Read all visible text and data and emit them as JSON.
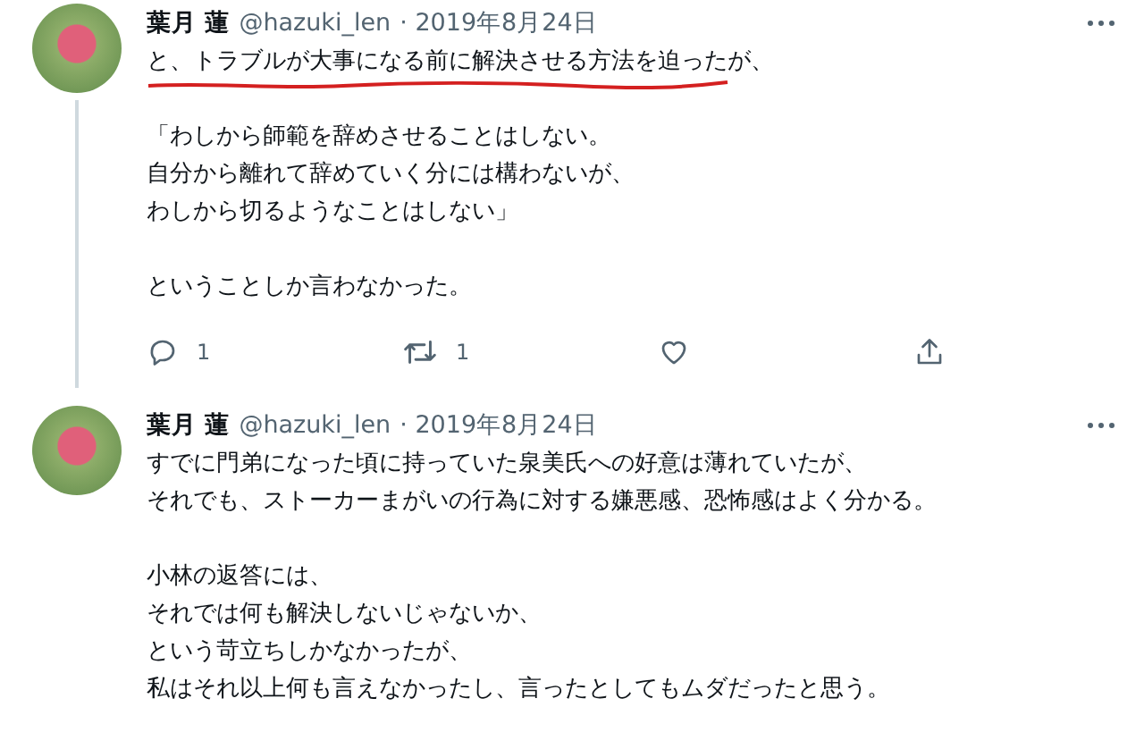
{
  "tweets": [
    {
      "name": "葉月 蓮",
      "handle": "@hazuki_len",
      "date": "· 2019年8月24日",
      "thread_line": true,
      "paragraphs": [
        {
          "lines": [
            "と、トラブルが大事になる前に解決させる方法を迫ったが、"
          ],
          "underlined": true
        },
        {
          "lines": [
            "「わしから師範を辞めさせることはしない。",
            "自分から離れて辞めていく分には構わないが、",
            "わしから切るようなことはしない」"
          ],
          "underlined": false
        },
        {
          "lines": [
            "ということしか言わなかった。"
          ],
          "underlined": false
        }
      ],
      "actions": [
        {
          "kind": "reply",
          "count": "1"
        },
        {
          "kind": "retweet",
          "count": "1"
        },
        {
          "kind": "like"
        },
        {
          "kind": "share"
        }
      ]
    },
    {
      "name": "葉月 蓮",
      "handle": "@hazuki_len",
      "date": "· 2019年8月24日",
      "thread_line": false,
      "paragraphs": [
        {
          "lines": [
            "すでに門弟になった頃に持っていた泉美氏への好意は薄れていたが、",
            "それでも、ストーカーまがいの行為に対する嫌悪感、恐怖感はよく分かる。"
          ],
          "underlined": false
        },
        {
          "lines": [
            "小林の返答には、",
            "それでは何も解決しないじゃないか、",
            "という苛立ちしかなかったが、",
            "私はそれ以上何も言えなかったし、言ったとしてもムダだったと思う。"
          ],
          "underlined": false
        }
      ]
    }
  ]
}
